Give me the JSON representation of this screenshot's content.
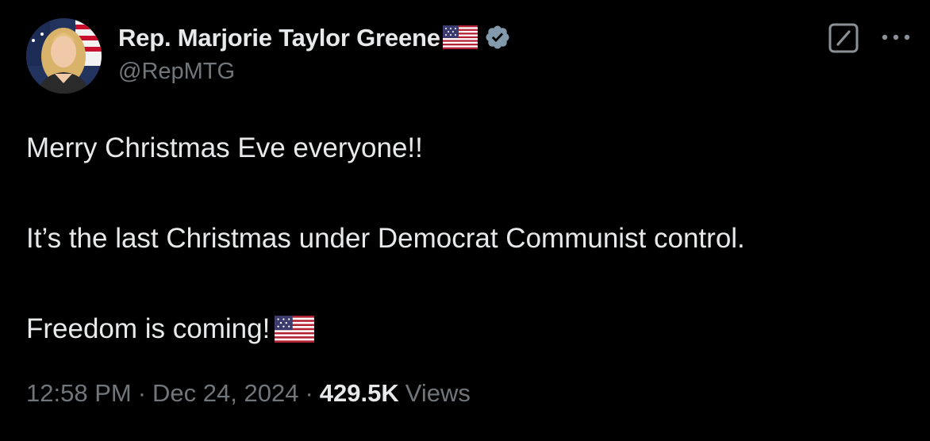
{
  "author": {
    "display_name": "Rep. Marjorie Taylor Greene",
    "handle": "@RepMTG",
    "avatar": "profile-photo",
    "name_emoji": "us-flag-icon",
    "badge": "verified-badge-icon",
    "badge_color": "#829aab"
  },
  "actions": {
    "grok_icon": "grok-icon",
    "more_icon": "more-options-icon"
  },
  "tweet": {
    "paragraphs": [
      "Merry Christmas Eve everyone!!",
      "It’s the last Christmas under Democrat Communist control.",
      "Freedom is coming!"
    ],
    "trailing_emoji": "us-flag-icon"
  },
  "meta": {
    "time": "12:58 PM",
    "separator": "·",
    "date": "Dec 24, 2024",
    "views_count": "429.5K",
    "views_label": "Views"
  },
  "colors": {
    "background": "#000000",
    "primary_text": "#e7e9ea",
    "secondary_text": "#71767b"
  }
}
